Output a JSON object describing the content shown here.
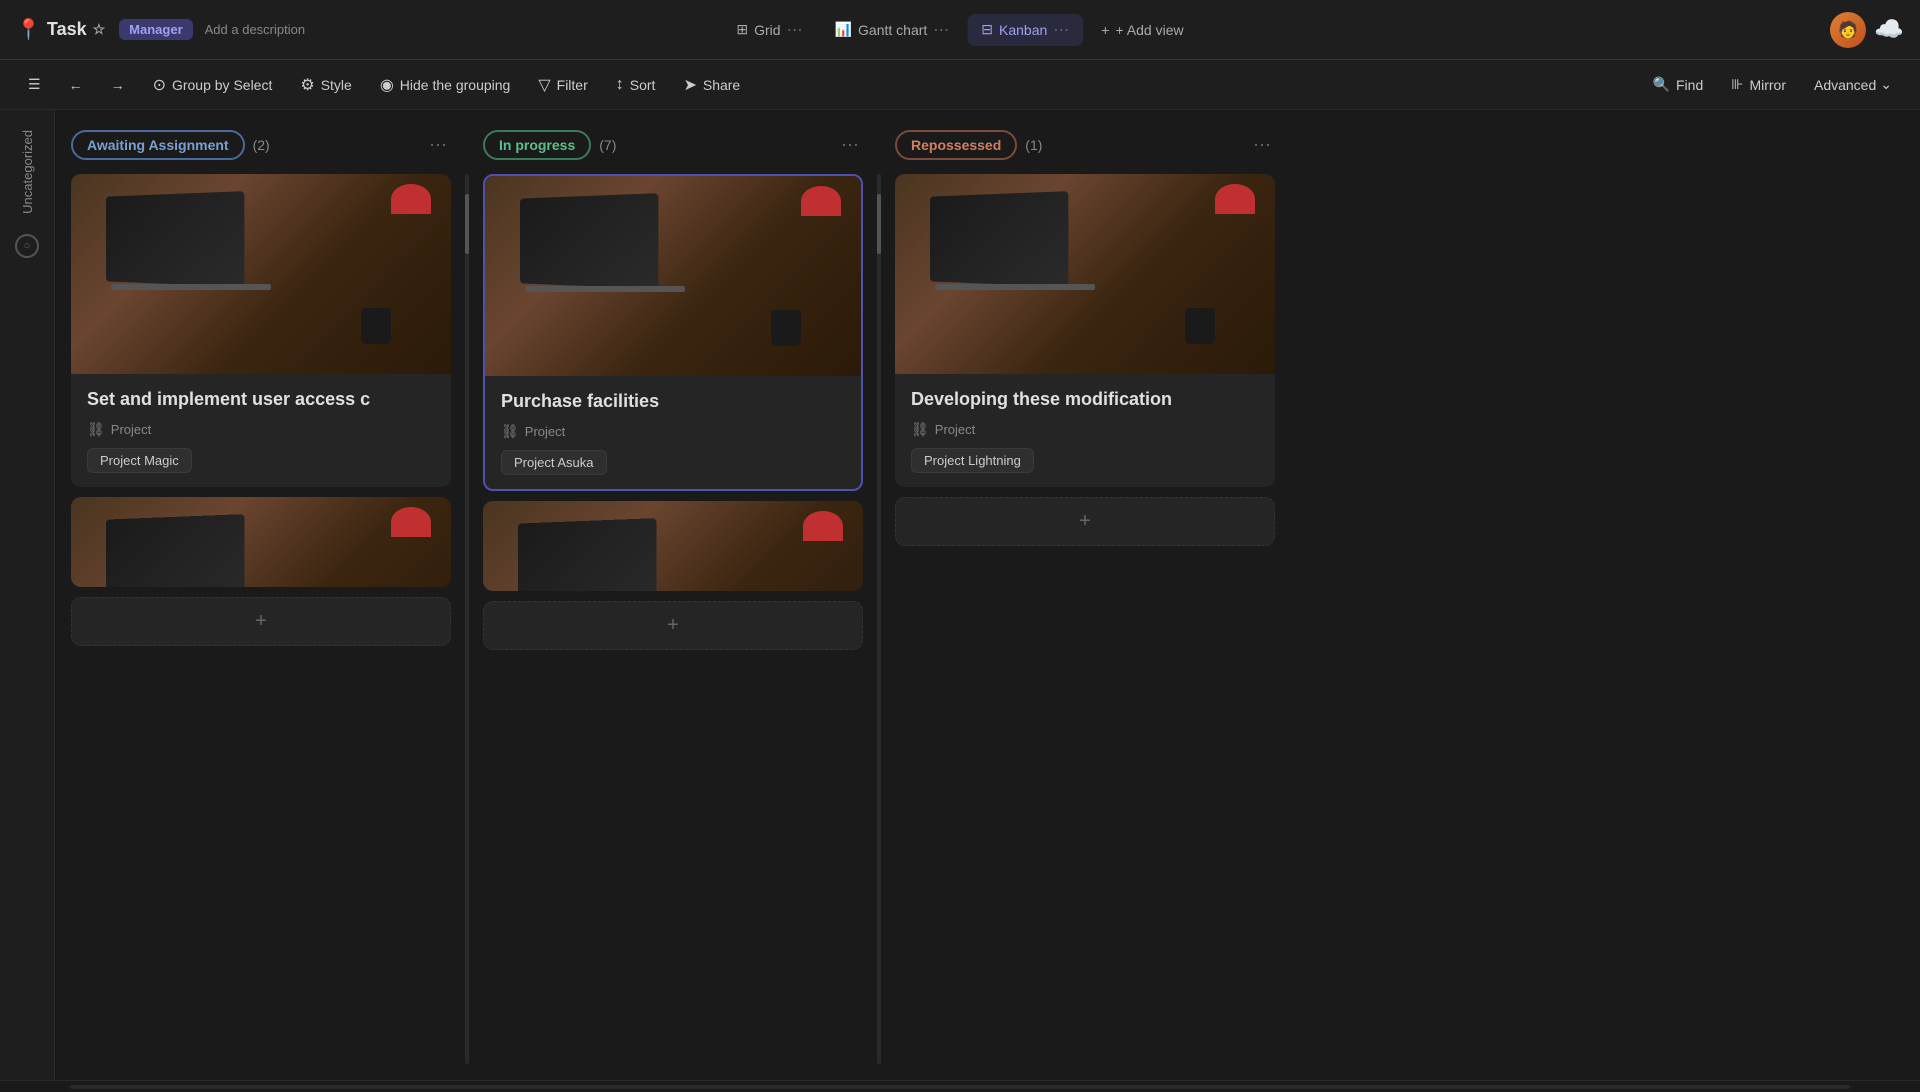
{
  "app": {
    "title": "Task",
    "badge": "Manager",
    "description": "Add a description"
  },
  "views": [
    {
      "id": "grid",
      "label": "Grid",
      "icon": "⊞",
      "active": false
    },
    {
      "id": "gantt",
      "label": "Gantt chart",
      "icon": "≡",
      "active": false
    },
    {
      "id": "kanban",
      "label": "Kanban",
      "icon": "⊟",
      "active": true
    }
  ],
  "add_view": "+ Add view",
  "toolbar": {
    "group_by": "Group by Select",
    "style": "Style",
    "hide_grouping": "Hide the grouping",
    "filter": "Filter",
    "sort": "Sort",
    "share": "Share",
    "find": "Find",
    "mirror": "Mirror",
    "advanced": "Advanced"
  },
  "columns": [
    {
      "id": "awaiting",
      "label": "Awaiting Assignment",
      "count": "(2)",
      "badge_class": "badge-awaiting",
      "cards": [
        {
          "id": "card1",
          "title": "Set and implement user access c",
          "project_label": "Project",
          "tag": "Project Magic",
          "has_image": true
        },
        {
          "id": "card2",
          "title": "",
          "has_image": true,
          "partial": true
        }
      ]
    },
    {
      "id": "inprogress",
      "label": "In progress",
      "count": "(7)",
      "badge_class": "badge-inprogress",
      "cards": [
        {
          "id": "card3",
          "title": "Purchase facilities",
          "project_label": "Project",
          "tag": "Project Asuka",
          "has_image": true,
          "dragging": true,
          "partial": false
        },
        {
          "id": "card4",
          "title": "",
          "has_image": true,
          "partial": true
        }
      ]
    },
    {
      "id": "repossessed",
      "label": "Repossessed",
      "count": "(1)",
      "badge_class": "badge-repossessed",
      "cards": [
        {
          "id": "card5",
          "title": "Developing these modification",
          "project_label": "Project",
          "tag": "Project Lightning",
          "has_image": true
        }
      ]
    }
  ],
  "add_card_label": "+",
  "uncategorized_label": "Uncategorized",
  "sidebar_icons": [
    "≡",
    "←",
    "→"
  ],
  "colors": {
    "background": "#1a1a1a",
    "card_bg": "#252525",
    "accent_kanban": "#a0a0f0",
    "accent_purple": "#5050b0"
  }
}
